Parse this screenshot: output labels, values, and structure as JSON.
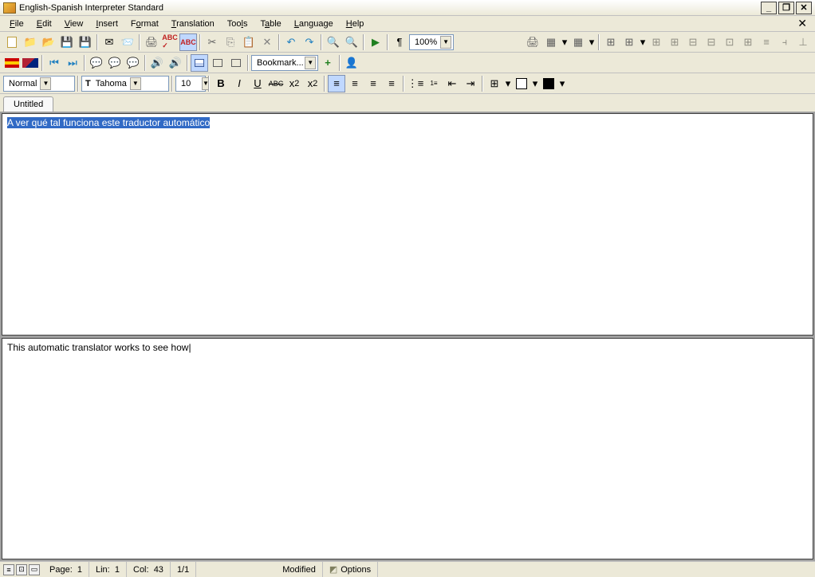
{
  "title": "English-Spanish Interpreter Standard",
  "menu": [
    "File",
    "Edit",
    "View",
    "Insert",
    "Format",
    "Translation",
    "Tools",
    "Table",
    "Language",
    "Help"
  ],
  "toolbar2": {
    "bookmark": "Bookmark..."
  },
  "format": {
    "style": "Normal",
    "font": "Tahoma",
    "size": "10"
  },
  "zoom": "100%",
  "tab": "Untitled",
  "source_text": "A ver qué tal funciona este traductor automático",
  "target_text": "This automatic translator works to see how",
  "status": {
    "page_label": "Page:",
    "page": "1",
    "lin_label": "Lin:",
    "lin": "1",
    "col_label": "Col:",
    "col": "43",
    "pages": "1/1",
    "modified": "Modified",
    "options": "Options"
  }
}
